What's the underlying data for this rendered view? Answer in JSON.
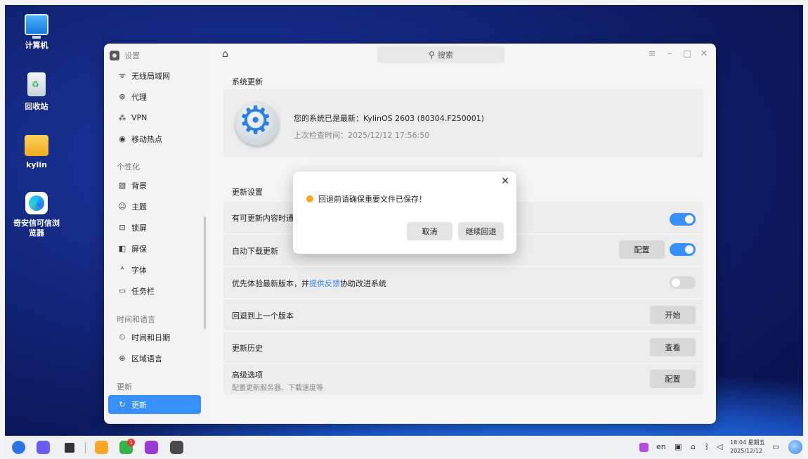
{
  "desktop": {
    "icons": [
      {
        "label": "计算机",
        "icon": "computer-icon"
      },
      {
        "label": "回收站",
        "icon": "trash-icon"
      },
      {
        "label": "kylin",
        "icon": "folder-icon"
      },
      {
        "label": "奇安信可信浏览器",
        "icon": "browser-icon"
      }
    ]
  },
  "window": {
    "app_title": "设置",
    "search_placeholder": "搜索"
  },
  "sidebar": {
    "items": [
      {
        "label": "无线局域网",
        "icon": "wifi-icon"
      },
      {
        "label": "代理",
        "icon": "proxy-icon"
      },
      {
        "label": "VPN",
        "icon": "vpn-icon"
      },
      {
        "label": "移动热点",
        "icon": "hotspot-icon"
      },
      {
        "label": "背景",
        "icon": "background-icon"
      },
      {
        "label": "主题",
        "icon": "theme-icon"
      },
      {
        "label": "锁屏",
        "icon": "lockscreen-icon"
      },
      {
        "label": "屏保",
        "icon": "screensaver-icon"
      },
      {
        "label": "字体",
        "icon": "font-icon"
      },
      {
        "label": "任务栏",
        "icon": "taskbar-icon"
      },
      {
        "label": "时间和日期",
        "icon": "clock-icon"
      },
      {
        "label": "区域语言",
        "icon": "region-icon"
      },
      {
        "label": "更新",
        "icon": "update-icon"
      }
    ],
    "groups": [
      "个性化",
      "时间和语言",
      "更新"
    ]
  },
  "main": {
    "system_update_title": "系统更新",
    "status_text": "您的系统已是最新：KylinOS 2603 (80304.F250001)",
    "last_check": "上次检查时间：2025/12/12 17:56:50",
    "update_settings_title": "更新设置",
    "rows": {
      "notify": "有可更新内容时通知",
      "auto_download": "自动下载更新",
      "config_label": "配置",
      "preview_prefix": "优先体验最新版本，并",
      "preview_link": "提供反馈",
      "preview_suffix": "协助改进系统",
      "rollback": "回退到上一个版本",
      "start_label": "开始",
      "history": "更新历史",
      "view_label": "查看",
      "advanced": "高级选项",
      "advanced_sub": "配置更新服务器、下载速度等",
      "advanced_config": "配置"
    },
    "toggles": {
      "notify": true,
      "auto_download": true,
      "preview": false
    }
  },
  "dialog": {
    "message": "回退前请确保重要文件已保存！",
    "cancel": "取消",
    "confirm": "继续回退"
  },
  "taskbar": {
    "lang": "en",
    "time": "18:04 星期五",
    "date": "2025/12/12",
    "badge_count": "1"
  },
  "colors": {
    "accent": "#3790fa",
    "warning": "#f5a623"
  }
}
